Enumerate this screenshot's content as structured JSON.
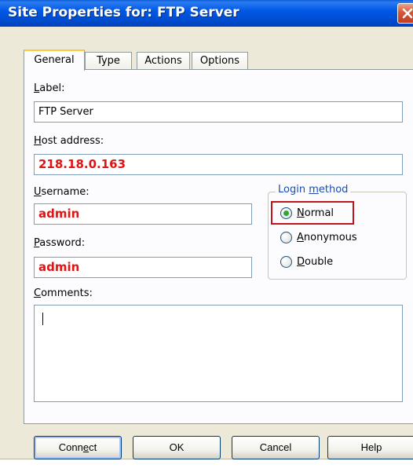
{
  "window": {
    "title": "Site Properties for: FTP Server",
    "tabs": [
      {
        "label": "General"
      },
      {
        "label": "Type"
      },
      {
        "label": "Actions"
      },
      {
        "label": "Options"
      }
    ]
  },
  "form": {
    "label_caption_u": "L",
    "label_caption_rest": "abel:",
    "label_value": "FTP Server",
    "host_caption_u": "H",
    "host_caption_rest": "ost address:",
    "host_value": "218.18.0.163",
    "username_caption_u": "U",
    "username_caption_rest": "sername:",
    "username_value": "admin",
    "password_caption_u": "P",
    "password_caption_rest": "assword:",
    "password_value": "admin",
    "comments_caption_u": "C",
    "comments_caption_rest": "omments:",
    "comments_value": ""
  },
  "login_method": {
    "legend_a": "Login ",
    "legend_u": "m",
    "legend_b": "ethod",
    "options": [
      {
        "u": "N",
        "rest": "ormal",
        "selected": true
      },
      {
        "u": "A",
        "rest": "nonymous",
        "selected": false
      },
      {
        "u": "D",
        "rest": "ouble",
        "selected": false
      }
    ]
  },
  "buttons": {
    "connect_a": "Conn",
    "connect_u": "e",
    "connect_b": "ct",
    "ok": "OK",
    "cancel": "Cancel",
    "help": "Help"
  },
  "colors": {
    "titlebar": "#0058E6",
    "highlight_text": "#E01414",
    "highlight_box": "#C0141E",
    "radio_dot": "#2FA63A",
    "window_bg": "#ECE9D8"
  }
}
